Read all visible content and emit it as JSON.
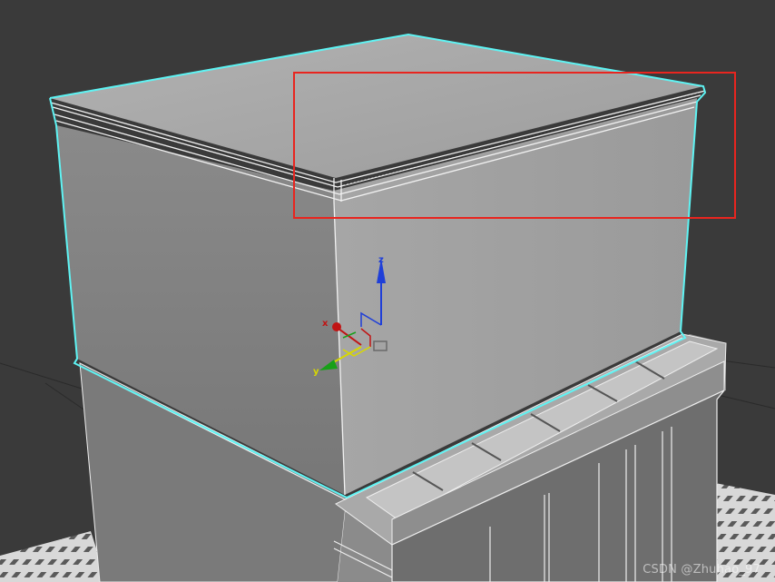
{
  "viewport": {
    "background": "#3a3a3a",
    "selection_color": "#5ef3f3",
    "highlight_box_color": "#e8251f"
  },
  "gizmo": {
    "x_label": "x",
    "y_label": "y",
    "z_label": "z",
    "x_color": "#c01414",
    "y_color": "#18a018",
    "z_color": "#1f3fd8",
    "plane_color": "#d8d800"
  },
  "watermark": "CSDN @Zhuhao_97"
}
